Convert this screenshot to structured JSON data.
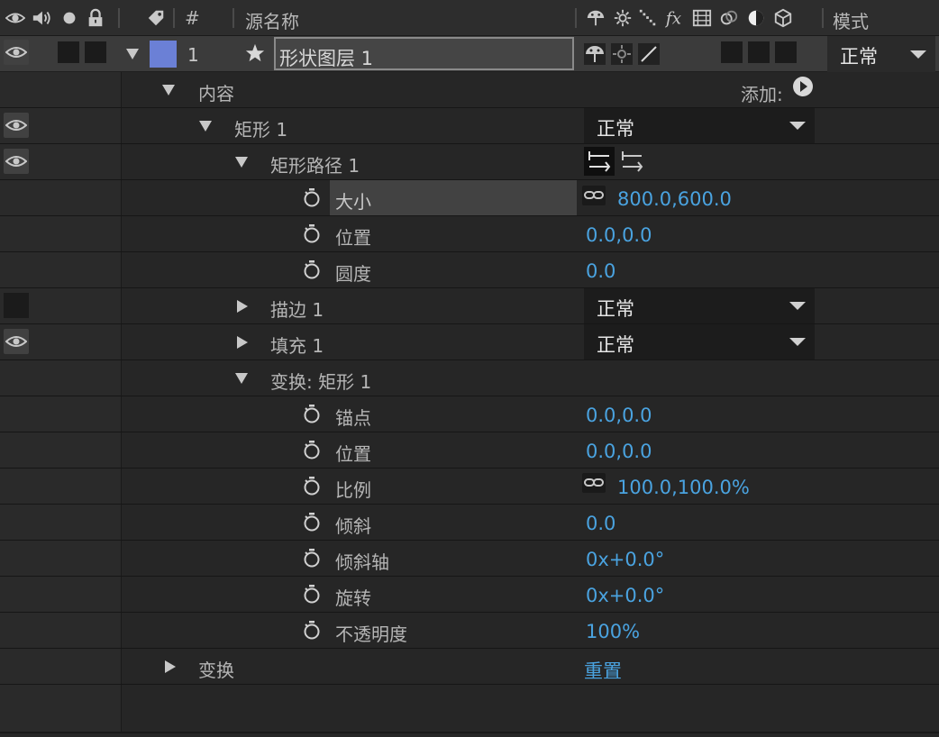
{
  "header": {
    "hash": "#",
    "source_name": "源名称",
    "mode": "模式"
  },
  "layer": {
    "number": "1",
    "name": "形状图层 1",
    "mode": "正常",
    "color": "#6b80d6"
  },
  "contents": {
    "label": "内容",
    "add_label": "添加:"
  },
  "rect_group": {
    "label": "矩形 1",
    "mode": "正常"
  },
  "rect_path": {
    "label": "矩形路径 1",
    "size": {
      "label": "大小",
      "value": "800.0,600.0"
    },
    "position": {
      "label": "位置",
      "value": "0.0,0.0"
    },
    "roundness": {
      "label": "圆度",
      "value": "0.0"
    }
  },
  "stroke": {
    "label": "描边 1",
    "mode": "正常"
  },
  "fill": {
    "label": "填充 1",
    "mode": "正常"
  },
  "transform_rect": {
    "label": "变换: 矩形 1",
    "anchor": {
      "label": "锚点",
      "value": "0.0,0.0"
    },
    "position": {
      "label": "位置",
      "value": "0.0,0.0"
    },
    "scale": {
      "label": "比例",
      "value": "100.0,100.0%"
    },
    "skew": {
      "label": "倾斜",
      "value": "0.0"
    },
    "skew_axis": {
      "label": "倾斜轴",
      "value": "0x+0.0°"
    },
    "rotation": {
      "label": "旋转",
      "value": "0x+0.0°"
    },
    "opacity": {
      "label": "不透明度",
      "value": "100%"
    }
  },
  "transform": {
    "label": "变换",
    "reset": "重置"
  },
  "colors": {
    "background": "#232323",
    "value_blue": "#4aa3e0",
    "layer_row": "#3b3b3b"
  }
}
